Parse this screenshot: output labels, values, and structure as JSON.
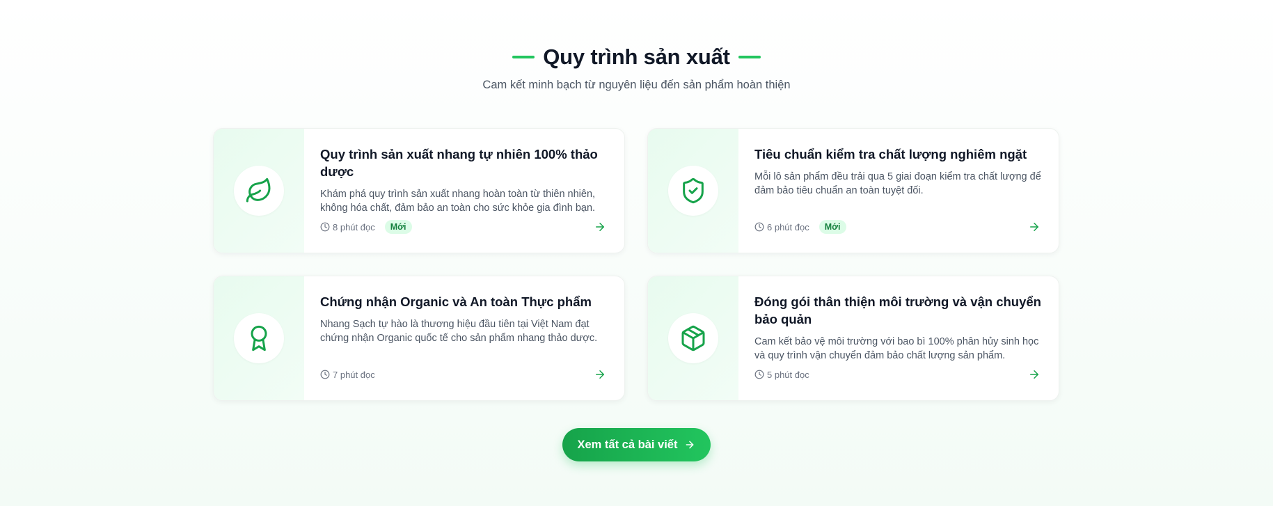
{
  "section": {
    "title": "Quy trình sản xuất",
    "subtitle": "Cam kết minh bạch từ nguyên liệu đến sản phẩm hoàn thiện"
  },
  "colors": {
    "accent": "#22c55e",
    "accent_dark": "#16a34a",
    "badge_bg": "#dcfce7",
    "badge_text": "#15803d"
  },
  "cards": [
    {
      "icon": "leaf-icon",
      "title": "Quy trình sản xuất nhang tự nhiên 100% thảo dược",
      "description": "Khám phá quy trình sản xuất nhang hoàn toàn từ thiên nhiên, không hóa chất, đảm bảo an toàn cho sức khỏe gia đình bạn.",
      "read_time": "8 phút đọc",
      "badge": "Mới"
    },
    {
      "icon": "shield-check-icon",
      "title": "Tiêu chuẩn kiểm tra chất lượng nghiêm ngặt",
      "description": "Mỗi lô sản phẩm đều trải qua 5 giai đoạn kiểm tra chất lượng để đảm bảo tiêu chuẩn an toàn tuyệt đối.",
      "read_time": "6 phút đọc",
      "badge": "Mới"
    },
    {
      "icon": "award-icon",
      "title": "Chứng nhận Organic và An toàn Thực phẩm",
      "description": "Nhang Sạch tự hào là thương hiệu đầu tiên tại Việt Nam đạt chứng nhận Organic quốc tế cho sản phẩm nhang thảo dược.",
      "read_time": "7 phút đọc",
      "badge": ""
    },
    {
      "icon": "package-icon",
      "title": "Đóng gói thân thiện môi trường và vận chuyển bảo quản",
      "description": "Cam kết bảo vệ môi trường với bao bì 100% phân hủy sinh học và quy trình vận chuyển đảm bảo chất lượng sản phẩm.",
      "read_time": "5 phút đọc",
      "badge": ""
    }
  ],
  "cta": {
    "label": "Xem tất cả bài viết",
    "icon": "arrow-right-icon"
  }
}
